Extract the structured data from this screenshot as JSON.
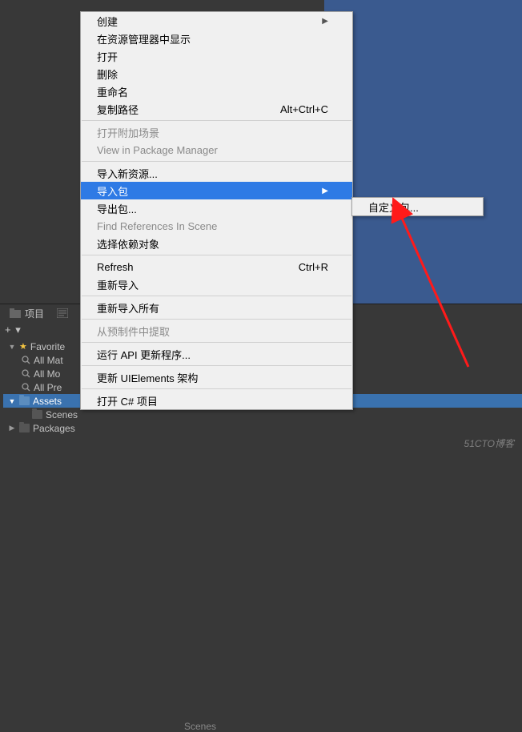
{
  "context_menu": {
    "items": [
      {
        "label": "创建",
        "submenu": true
      },
      {
        "label": "在资源管理器中显示"
      },
      {
        "label": "打开"
      },
      {
        "label": "删除"
      },
      {
        "label": "重命名"
      },
      {
        "label": "复制路径",
        "shortcut": "Alt+Ctrl+C"
      },
      {
        "sep": true
      },
      {
        "label": "打开附加场景",
        "disabled": true
      },
      {
        "label": "View in Package Manager",
        "disabled": true
      },
      {
        "sep": true
      },
      {
        "label": "导入新资源..."
      },
      {
        "label": "导入包",
        "submenu": true,
        "hover": true
      },
      {
        "label": "导出包..."
      },
      {
        "label": "Find References In Scene",
        "disabled": true
      },
      {
        "label": "选择依赖对象"
      },
      {
        "sep": true
      },
      {
        "label": "Refresh",
        "shortcut": "Ctrl+R"
      },
      {
        "label": "重新导入"
      },
      {
        "sep": true
      },
      {
        "label": "重新导入所有"
      },
      {
        "sep": true
      },
      {
        "label": "从预制件中提取",
        "disabled": true
      },
      {
        "sep": true
      },
      {
        "label": "运行 API 更新程序..."
      },
      {
        "sep": true
      },
      {
        "label": "更新 UIElements 架构"
      },
      {
        "sep": true
      },
      {
        "label": "打开 C# 项目"
      }
    ]
  },
  "submenu": {
    "items": [
      {
        "label": "自定义包..."
      }
    ]
  },
  "project_panel": {
    "tab": "项目",
    "plus": "+ ▾",
    "favorites": "Favorite",
    "searches": [
      "All Mat",
      "All Mo",
      "All Pre"
    ],
    "assets": "Assets",
    "scenes": "Scenes",
    "packages": "Packages",
    "content_label": "Scenes"
  },
  "watermark": "51CTO博客"
}
